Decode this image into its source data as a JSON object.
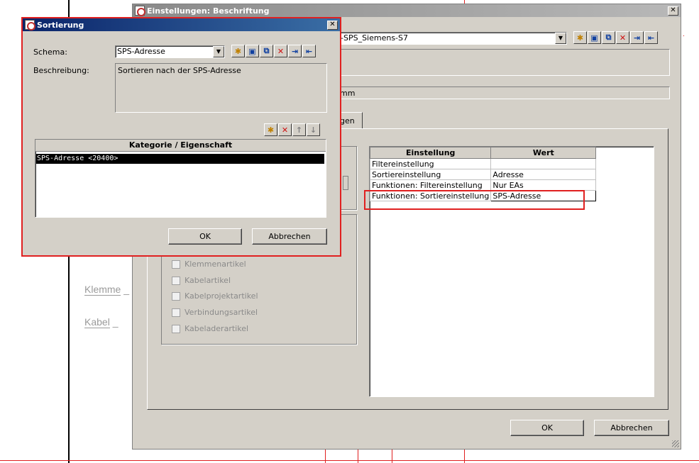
{
  "background": {
    "labels": [
      "Klemme",
      "Kabel"
    ]
  },
  "main_dialog": {
    "title": "Einstellungen: Beschriftung",
    "close_glyph": "✕",
    "schema_value_partial": "-SPS_Siemens-S7",
    "field_partial": "mm",
    "tab_partial": "gen",
    "grid": {
      "headers": [
        "Einstellung",
        "Wert"
      ],
      "rows": [
        {
          "setting": "Filtereinstellung",
          "value": ""
        },
        {
          "setting": "Sortiereinstellung",
          "value": "Adresse"
        },
        {
          "setting": "Funktionen: Filtereinstellung",
          "value": "Nur EAs"
        },
        {
          "setting": "Funktionen: Sortiereinstellung",
          "value": "SPS-Adresse"
        }
      ]
    },
    "checkboxes": [
      "Klemmenartikel",
      "Kabelartikel",
      "Kabelprojektartikel",
      "Verbindungsartikel",
      "Kabeladerartikel"
    ],
    "ok_label": "OK",
    "cancel_label": "Abbrechen"
  },
  "sort_dialog": {
    "title": "Sortierung",
    "close_glyph": "✕",
    "schema_label": "Schema:",
    "schema_value": "SPS-Adresse",
    "description_label": "Beschreibung:",
    "description_value": "Sortieren nach der SPS-Adresse",
    "list_header": "Kategorie / Eigenschaft",
    "list_items": [
      "SPS-Adresse <20400>"
    ],
    "ok_label": "OK",
    "cancel_label": "Abbrechen"
  },
  "colors": {
    "active_title": "#0a246a",
    "inactive_title": "#8a8a8a",
    "highlight": "#e02020",
    "window_face": "#d4d0c8"
  },
  "icons": [
    "new-icon",
    "save-icon",
    "copy-icon",
    "delete-icon",
    "import-icon",
    "export-icon",
    "arrow-up-icon",
    "arrow-down-icon",
    "dropdown-arrow-icon"
  ]
}
